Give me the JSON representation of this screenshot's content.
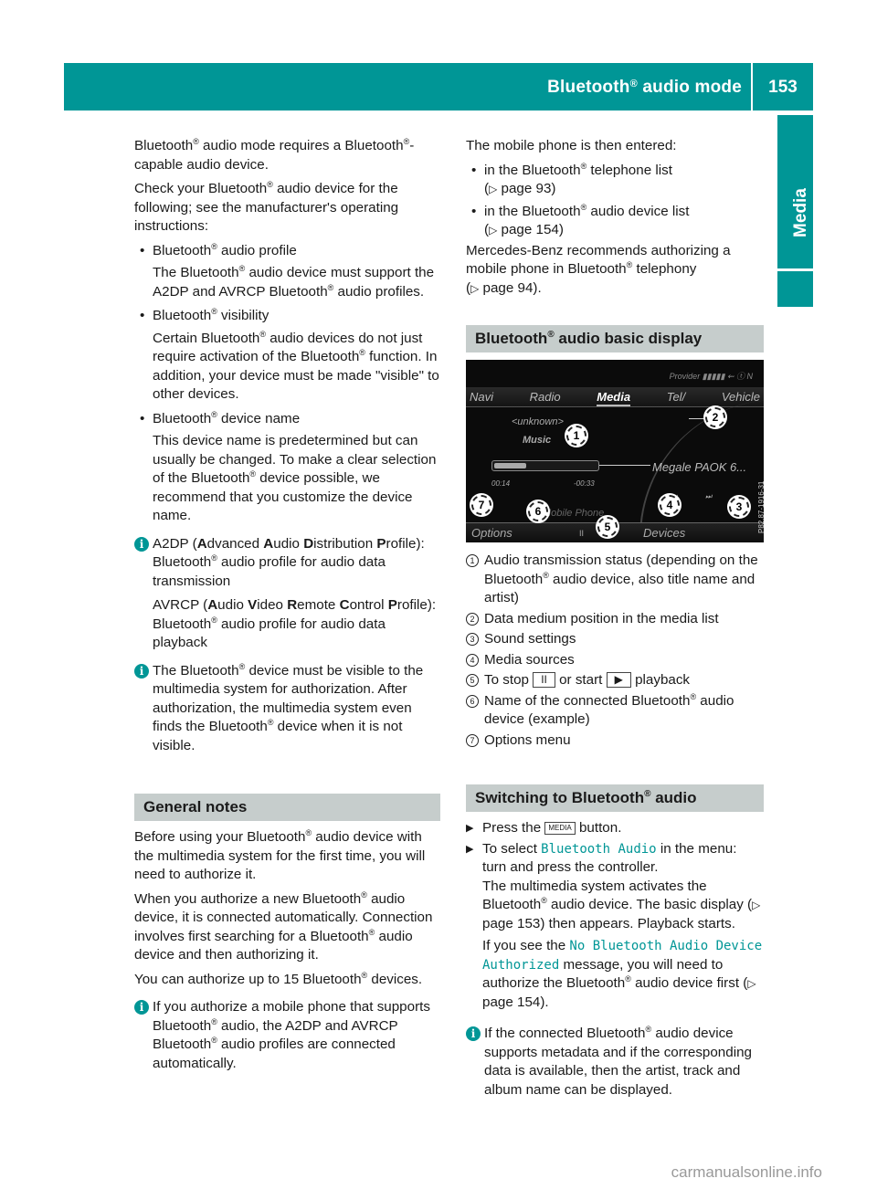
{
  "header": {
    "title_pre": "Bluetooth",
    "title_reg": "®",
    "title_post": " audio mode",
    "page_number": "153"
  },
  "side_tab": {
    "label": "Media"
  },
  "left_column": {
    "intro1_a": "Bluetooth",
    "intro1_b": " audio mode requires a Bluetooth",
    "intro1_c": "-capable audio device.",
    "intro2_a": "Check your Bluetooth",
    "intro2_b": " audio device for the following; see the manufacturer's operating instructions:",
    "bullets": [
      {
        "head_a": "Bluetooth",
        "head_b": " audio profile",
        "body_a": "The Bluetooth",
        "body_b": " audio device must support the A2DP and AVRCP Bluetooth",
        "body_c": " audio profiles."
      },
      {
        "head_a": "Bluetooth",
        "head_b": " visibility",
        "body_a": "Certain Bluetooth",
        "body_b": " audio devices do not just require activation of the Bluetooth",
        "body_c": " function. In addition, your device must be made \"visible\" to other devices."
      },
      {
        "head_a": "Bluetooth",
        "head_b": " device name",
        "body_a": "This device name is predetermined but can usually be changed. To make a clear selection of the Bluetooth",
        "body_b": " device possible, we recommend that you customize the device name.",
        "body_c": ""
      }
    ],
    "info1": {
      "a2dp_pre": "A2DP (",
      "a2dp_A": "A",
      "a2dp_dv": "dvanced ",
      "a2dp_Au": "A",
      "a2dp_udio": "udio ",
      "a2dp_D": "D",
      "a2dp_istribution": "istribution ",
      "a2dp_P": "P",
      "a2dp_rofile": "rofile):",
      "a2dp_desc_a": "Bluetooth",
      "a2dp_desc_b": " audio profile for audio data transmission",
      "avrcp_pre": "AVRCP (",
      "avrcp_A": "A",
      "avrcp_udio": "udio ",
      "avrcp_V": "V",
      "avrcp_ideo": "ideo ",
      "avrcp_R": "R",
      "avrcp_emote": "emote ",
      "avrcp_C": "C",
      "avrcp_ontrol": "ontrol ",
      "avrcp_P": "P",
      "avrcp_rofile": "rofile):",
      "avrcp_desc_a": "Bluetooth",
      "avrcp_desc_b": " audio profile for audio data playback"
    },
    "info2_a": "The Bluetooth",
    "info2_b": " device must be visible to the multimedia system for authorization. After authorization, the multimedia system even finds the Bluetooth",
    "info2_c": " device when it is not visible.",
    "general_notes": {
      "title": "General notes",
      "p1_a": "Before using your Bluetooth",
      "p1_b": " audio device with the multimedia system for the first time, you will need to authorize it.",
      "p2_a": "When you authorize a new Bluetooth",
      "p2_b": " audio device, it is connected automatically. Connection involves first searching for a Bluetooth",
      "p2_c": " audio device and then authorizing it.",
      "p3_a": "You can authorize up to 15 Bluetooth",
      "p3_b": " devices.",
      "info_a": "If you authorize a mobile phone that supports Bluetooth",
      "info_b": " audio, the A2DP and AVRCP Bluetooth",
      "info_c": " audio profiles are connected automatically."
    }
  },
  "right_column": {
    "entered": "The mobile phone is then entered:",
    "entered_items": [
      {
        "a": "in the Bluetooth",
        "b": " telephone list",
        "ref": "page 93)"
      },
      {
        "a": "in the Bluetooth",
        "b": " audio device list",
        "ref": "page 154)"
      }
    ],
    "recommend_a": "Mercedes-Benz recommends authorizing a mobile phone in Bluetooth",
    "recommend_b": " telephony",
    "recommend_ref": "page 94).",
    "basic_display": {
      "title_a": "Bluetooth",
      "title_b": " audio basic display",
      "screen": {
        "status": "Provider ▮▮▮▮▮ ⇜ ⓣ N",
        "nav": [
          "Navi",
          "Radio",
          "Media",
          "Tel/",
          "Vehicle"
        ],
        "active_nav": "Media",
        "unknown": "<unknown>",
        "music": "Music",
        "time_elapsed": "00:14",
        "time_remaining": "-00:33",
        "progress": 0.3,
        "device_name": "Megale PAOK 6...",
        "connected_name": "Mobile Phone",
        "bottom_left": "Options",
        "bottom_mid": "II",
        "bottom_right": "Devices",
        "side_code": "P82.87-1916-31",
        "callouts": [
          "1",
          "2",
          "3",
          "4",
          "5",
          "6",
          "7"
        ]
      },
      "legend": [
        {
          "num": "1",
          "a": "Audio transmission status (depending on the Bluetooth",
          "b": " audio device, also title name and artist)"
        },
        {
          "num": "2",
          "a": "Data medium position in the media list",
          "b": ""
        },
        {
          "num": "3",
          "a": "Sound settings",
          "b": ""
        },
        {
          "num": "4",
          "a": "Media sources",
          "b": ""
        },
        {
          "num": "5",
          "stop_pre": "To stop",
          "stop_key": "II",
          "or_start": "or start",
          "play_key": "▶",
          "post": "playback"
        },
        {
          "num": "6",
          "a": "Name of the connected Bluetooth",
          "b": " audio device (example)"
        },
        {
          "num": "7",
          "a": "Options menu",
          "b": ""
        }
      ]
    },
    "switching": {
      "title_a": "Switching to Bluetooth",
      "title_b": " audio",
      "step1_pre": "Press the",
      "step1_key": "MEDIA",
      "step1_post": "button.",
      "step2_pre": "To select",
      "step2_menu": "Bluetooth Audio",
      "step2_post": "in the menu: turn and press the controller.",
      "step2_result_a": "The multimedia system activates the Bluetooth",
      "step2_result_b": " audio device. The basic display (",
      "step2_result_ref": "page 153) then appears. Playback starts.",
      "step2_if_pre": "If you see the",
      "step2_msg": "No Bluetooth Audio Device Authorized",
      "step2_if_post_a": "message, you will need to authorize the Bluetooth",
      "step2_if_post_b": " audio device first (",
      "step2_if_ref": "page 154).",
      "info_a": "If the connected Bluetooth",
      "info_b": " audio device supports metadata and if the corresponding data is available, then the artist, track and album name can be displayed."
    }
  },
  "registered": "®",
  "xref_arrow": "▷",
  "step_arrow": "▶",
  "info_glyph": "i",
  "footer": {
    "watermark": "carmanualsonline.info"
  },
  "colors": {
    "accent": "#009696",
    "section_bg": "#c6cdcc"
  }
}
